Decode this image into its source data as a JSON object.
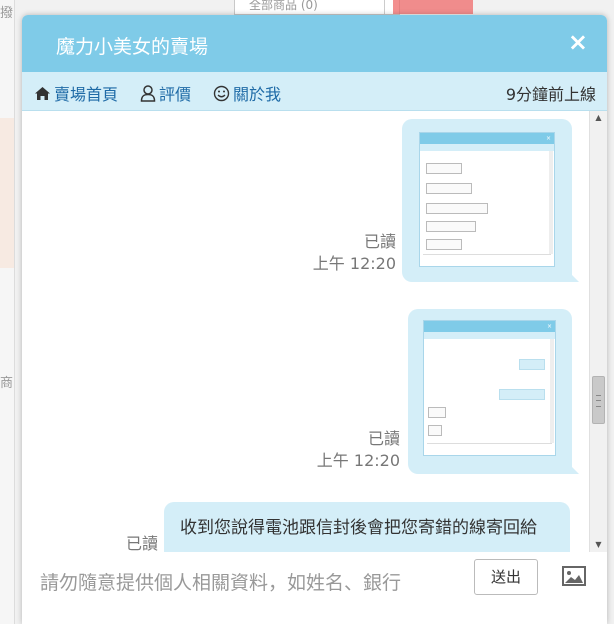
{
  "background": {
    "left_char_top": "撥",
    "left_char_mid": "商",
    "select_text": "全部商品 (0)"
  },
  "header": {
    "title": "魔力小美女的賣場",
    "close": "×"
  },
  "nav": {
    "home": "賣場首頁",
    "rate": "評價",
    "about": "關於我",
    "online_status": "9分鐘前上線"
  },
  "messages": [
    {
      "type": "image",
      "status": "已讀",
      "time": "上午 12:20"
    },
    {
      "type": "image",
      "status": "已讀",
      "time": "上午 12:20"
    },
    {
      "type": "text",
      "status": "已讀",
      "text": "收到您說得電池跟信封後會把您寄錯的線寄回給"
    }
  ],
  "footer": {
    "placeholder": "請勿隨意提供個人相關資料，如姓名、銀行",
    "send": "送出"
  },
  "colors": {
    "header": "#7fcbe8",
    "nav": "#d4eef8",
    "link": "#1e6aa6"
  }
}
